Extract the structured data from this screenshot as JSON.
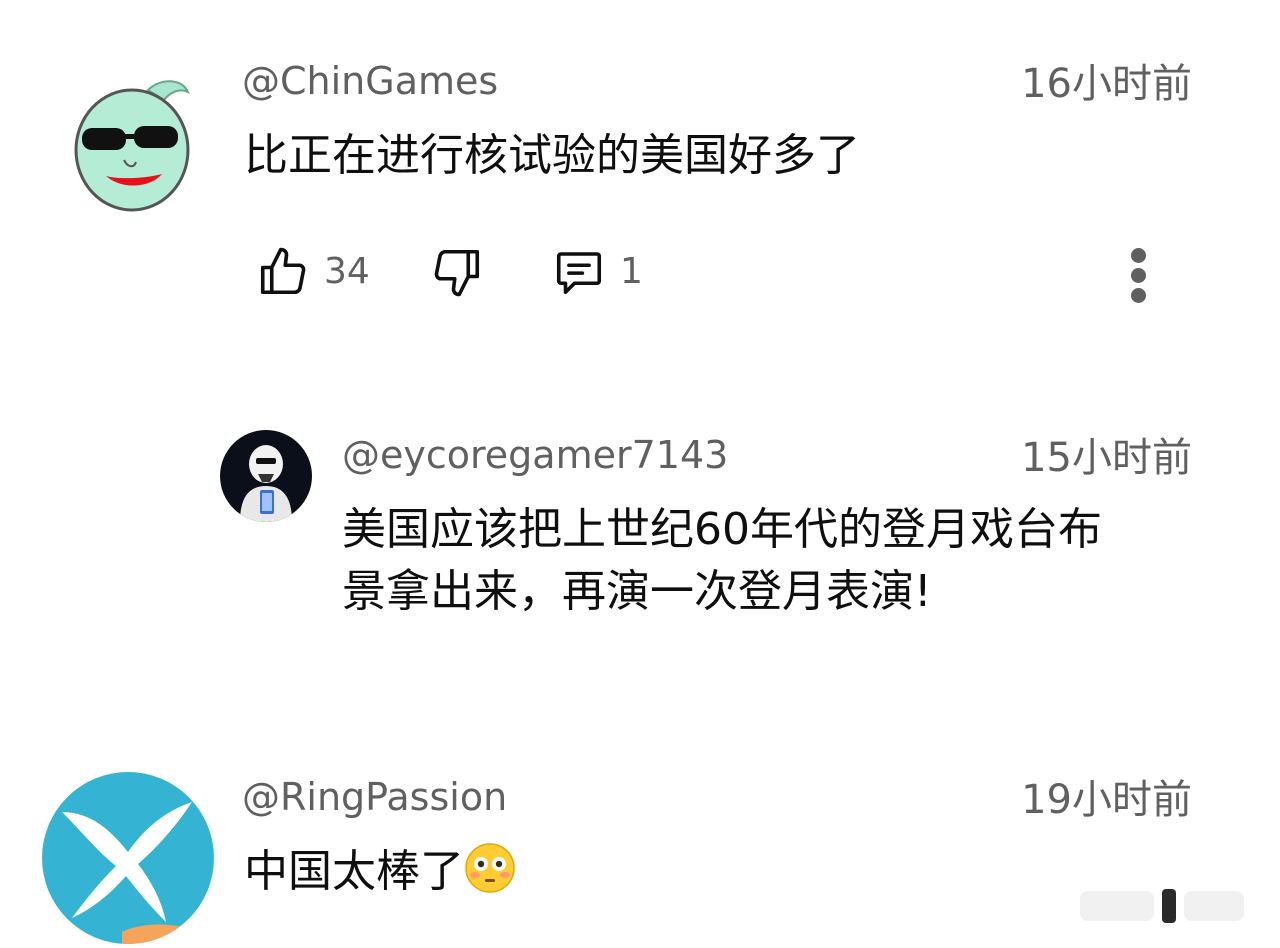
{
  "comments": [
    {
      "handle": "@ChinGames",
      "time": "16小时前",
      "text": "比正在进行核试验的美国好多了",
      "like_count": "34",
      "reply_count": "1",
      "avatar": "cartoon-face-sunglasses-avatar"
    },
    {
      "handle": "@eycoregamer7143",
      "time": "15小时前",
      "text_line1": "美国应该把上世纪60年代的登月戏台布",
      "text_line2": "景拿出来，再演一次登月表演!",
      "avatar": "stormtrooper-avatar"
    },
    {
      "handle": "@RingPassion",
      "time": "19小时前",
      "text": "中国太棒了",
      "emoji": "flushed-face-emoji",
      "avatar": "white-bird-avatar"
    }
  ],
  "icons": {
    "like": "thumbs-up-icon",
    "dislike": "thumbs-down-icon",
    "reply": "comment-icon",
    "more": "more-vert-icon"
  },
  "colors": {
    "secondary_text": "#606060",
    "primary_text": "#0f0f0f",
    "background": "#ffffff"
  }
}
